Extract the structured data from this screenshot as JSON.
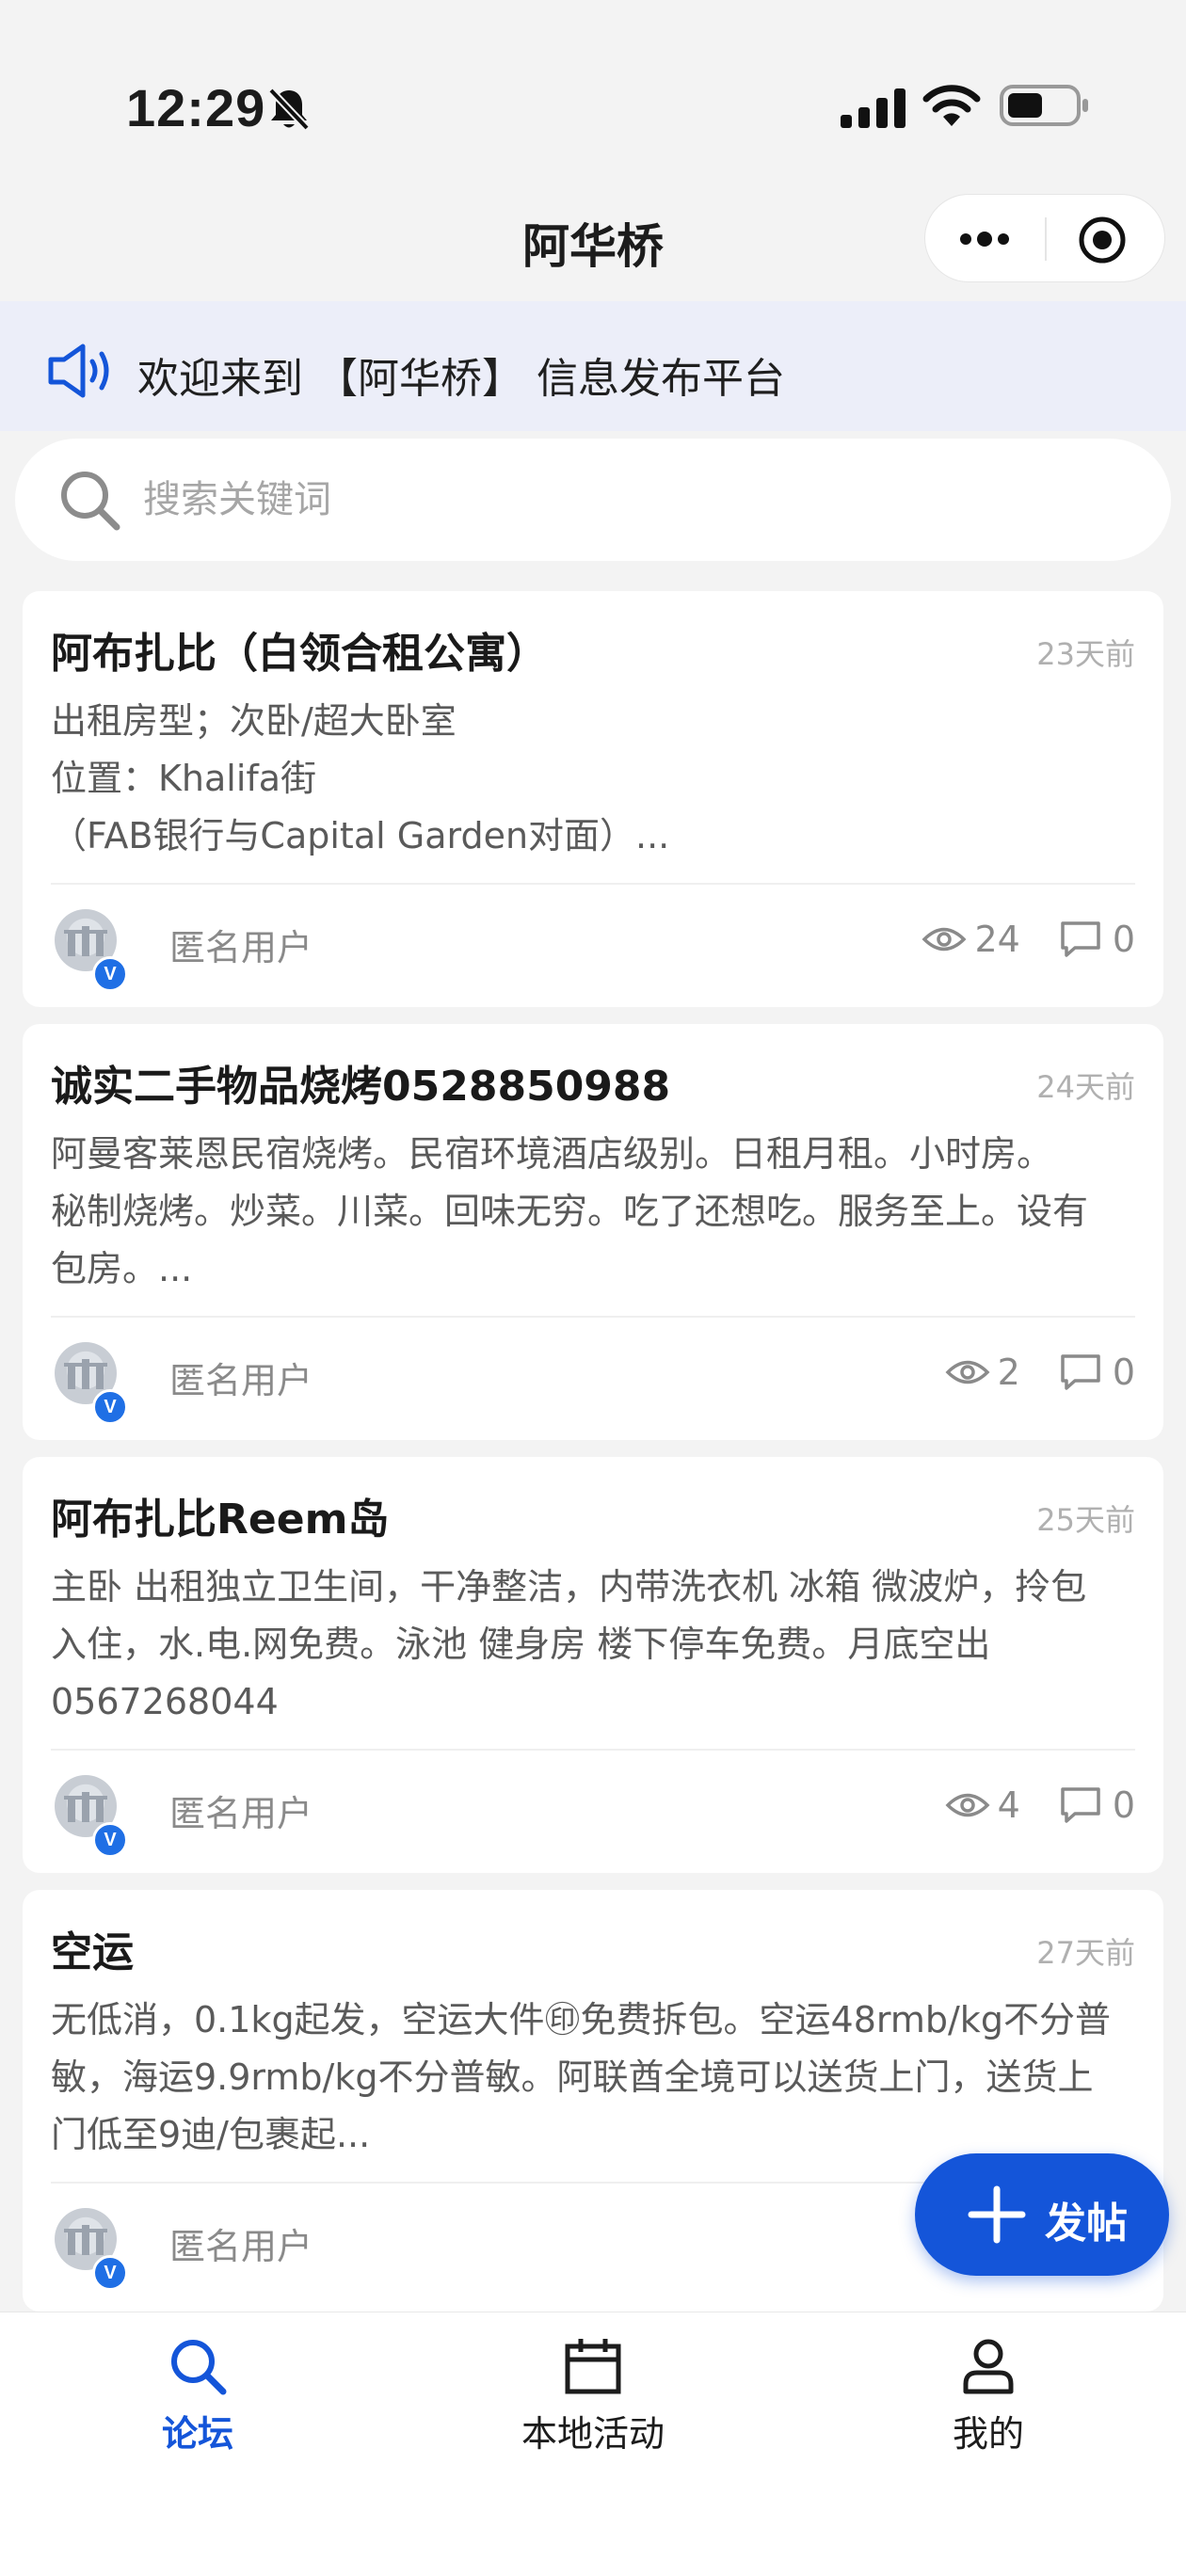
{
  "status_bar": {
    "time": "12:29"
  },
  "nav": {
    "title": "阿华桥"
  },
  "announcement": {
    "text": "欢迎来到 【阿华桥】 信息发布平台"
  },
  "search": {
    "placeholder": "搜索关键词",
    "value": ""
  },
  "posts": [
    {
      "title": "阿布扎比（白领合租公寓）",
      "time": "23天前",
      "lines": [
        "出租房型；次卧/超大卧室",
        "位置：Khalifa街",
        "（FAB银行与Capital Garden对面）..."
      ],
      "author": "匿名用户",
      "views": "24",
      "comments": "0"
    },
    {
      "title": "诚实二手物品烧烤0528850988",
      "time": "24天前",
      "lines": [
        "阿曼客莱恩民宿烧烤。民宿环境酒店级别。日租月租。小时房。",
        "秘制烧烤。炒菜。川菜。回味无穷。吃了还想吃。服务至上。设有",
        "包房。..."
      ],
      "author": "匿名用户",
      "views": "2",
      "comments": "0"
    },
    {
      "title": "阿布扎比Reem岛",
      "time": "25天前",
      "lines": [
        "主卧 出租独立卫生间，干净整洁，内带洗衣机 冰箱 微波炉，拎包",
        "入住，水.电.网免费。泳池 健身房 楼下停车免费。月底空出",
        "0567268044"
      ],
      "author": "匿名用户",
      "views": "4",
      "comments": "0"
    },
    {
      "title": "空运",
      "time": "27天前",
      "lines": [
        "无低消，0.1kg起发，空运大件㊞免费拆包。空运48rmb/kg不分普",
        "敏，海运9.9rmb/kg不分普敏。阿联酋全境可以送货上门，送货上",
        "门低至9迪/包裹起..."
      ],
      "author": "匿名用户",
      "views": "",
      "comments": ""
    }
  ],
  "fab": {
    "label": "发帖"
  },
  "tabs": [
    {
      "label": "论坛",
      "icon": "search-icon",
      "active": true
    },
    {
      "label": "本地活动",
      "icon": "calendar-icon",
      "active": false
    },
    {
      "label": "我的",
      "icon": "person-icon",
      "active": false
    }
  ],
  "colors": {
    "accent": "#1455d9",
    "badge": "#1f6fe5",
    "announcement_bg": "#eceef9"
  }
}
